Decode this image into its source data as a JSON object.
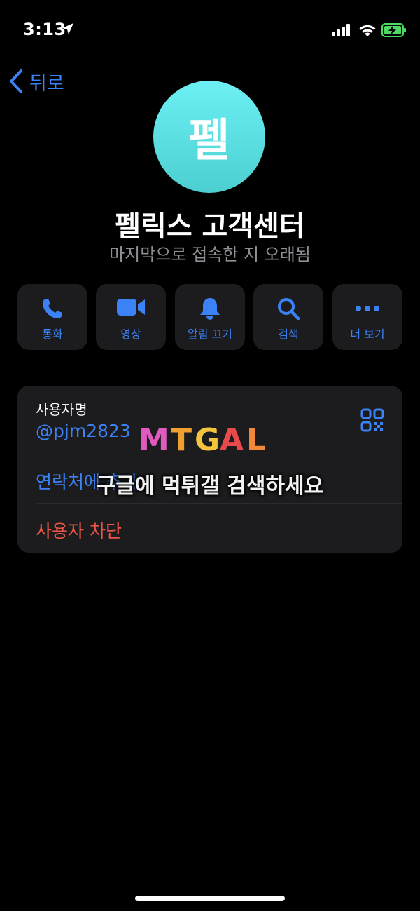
{
  "status_bar": {
    "time": "3:13",
    "icons": [
      "location-arrow-icon",
      "signal-icon",
      "wifi-icon",
      "battery-charging-icon"
    ],
    "battery_color": "#4cd964"
  },
  "nav": {
    "back_label": "뒤로",
    "back_icon": "chevron-left-icon"
  },
  "profile": {
    "avatar_initial": "펠",
    "avatar_color": "#5ad9dc",
    "name": "펠릭스 고객센터",
    "last_seen": "마지막으로 접속한 지 오래됨"
  },
  "actions": [
    {
      "label": "통화",
      "icon": "phone-icon"
    },
    {
      "label": "영상",
      "icon": "video-camera-icon"
    },
    {
      "label": "알림 끄기",
      "icon": "bell-icon"
    },
    {
      "label": "검색",
      "icon": "search-icon"
    },
    {
      "label": "더 보기",
      "icon": "more-icon"
    }
  ],
  "info": {
    "username_title": "사용자명",
    "username": "@pjm2823",
    "add_contact_label": "연락처에 추가",
    "block_label": "사용자 차단"
  },
  "watermark": {
    "logo_text": "MTGAL",
    "caption": "구글에 먹튀갤 검색하세요"
  },
  "colors": {
    "accent": "#3b82f6",
    "danger": "#eb5545",
    "card": "#1c1c1e"
  }
}
